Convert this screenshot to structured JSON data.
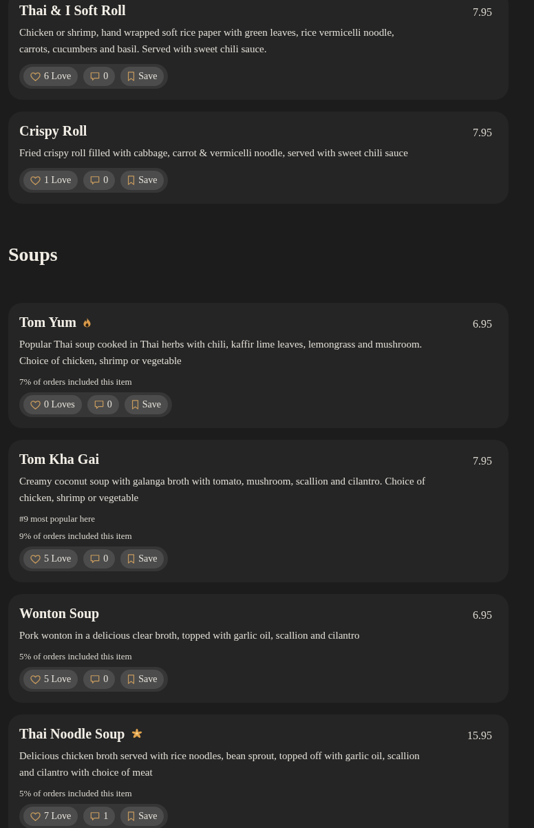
{
  "sections": [
    {
      "items": [
        {
          "name": "Thai & I Soft Roll",
          "kind": "plain",
          "price": "7.95",
          "description": "Chicken or shrimp, hand wrapped soft rice paper with green leaves, rice vermicelli noodle, carrots, cucumbers and basil. Served with sweet chili sauce.",
          "love": "6 Love",
          "comments": "0",
          "save": "Save"
        },
        {
          "name": "Crispy Roll",
          "kind": "plain",
          "price": "7.95",
          "description": "Fried crispy roll filled with cabbage, carrot & vermicelli noodle, served with sweet chili sauce",
          "love": "1 Love",
          "comments": "0",
          "save": "Save"
        }
      ]
    },
    {
      "heading": "Soups",
      "items": [
        {
          "name": "Tom Yum",
          "kind": "flame",
          "price": "6.95",
          "description": "Popular Thai soup cooked in Thai herbs with chili, kaffir lime leaves, lemongrass and mushroom. Choice of chicken, shrimp or vegetable",
          "stats": [
            "7% of orders included this item"
          ],
          "love": "0 Loves",
          "comments": "0",
          "save": "Save"
        },
        {
          "name": "Tom Kha Gai",
          "kind": "plain",
          "price": "7.95",
          "description": "Creamy coconut soup with galanga broth with tomato, mushroom, scallion and cilantro. Choice of chicken, shrimp or vegetable",
          "stats": [
            "#9 most popular here",
            "9% of orders included this item"
          ],
          "love": "5 Love",
          "comments": "0",
          "save": "Save"
        },
        {
          "name": "Wonton Soup",
          "kind": "plain",
          "price": "6.95",
          "description": "Pork wonton in a delicious clear broth, topped with garlic oil, scallion and cilantro",
          "stats": [
            "5% of orders included this item"
          ],
          "love": "5 Love",
          "comments": "0",
          "save": "Save"
        },
        {
          "name": "Thai Noodle Soup",
          "kind": "flower",
          "price": "15.95",
          "description": "Delicious chicken broth served with rice noodles, bean sprout, topped off with garlic oil, scallion and cilantro with choice of meat",
          "stats": [
            "5% of orders included this item"
          ],
          "love": "7 Love",
          "comments": "1",
          "save": "Save"
        }
      ]
    }
  ]
}
